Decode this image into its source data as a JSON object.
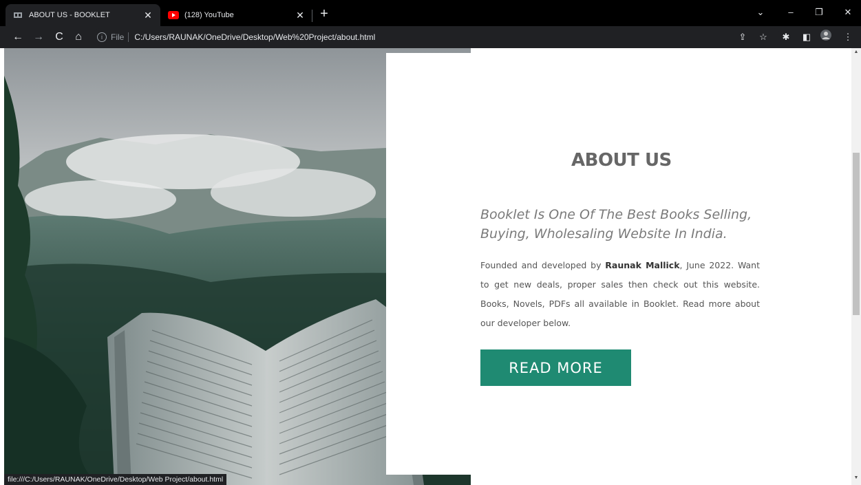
{
  "browser": {
    "tabs": [
      {
        "title": "ABOUT US - BOOKLET",
        "favicon": "booklet-icon",
        "active": true
      },
      {
        "title": "(128) YouTube",
        "favicon": "youtube-icon",
        "active": false
      }
    ],
    "address": {
      "scheme_label": "File",
      "url": "C:/Users/RAUNAK/OneDrive/Desktop/Web%20Project/about.html"
    },
    "status_url": "file:///C:/Users/RAUNAK/OneDrive/Desktop/Web Project/about.html"
  },
  "page": {
    "title": "ABOUT US",
    "subtitle": "Booklet Is One Of The Best Books Selling, Buying, Wholesaling Website In India.",
    "body_prefix": "Founded and developed by ",
    "founder": "Raunak Mallick",
    "body_suffix": ", June 2022. Want to get new deals, proper sales then check out this website. Books, Novels, PDFs all available in Booklet. Read more about our developer below.",
    "button_label": "READ MORE"
  },
  "colors": {
    "button": "#1f8a72",
    "heading": "#666666",
    "chrome_bg": "#202124"
  }
}
